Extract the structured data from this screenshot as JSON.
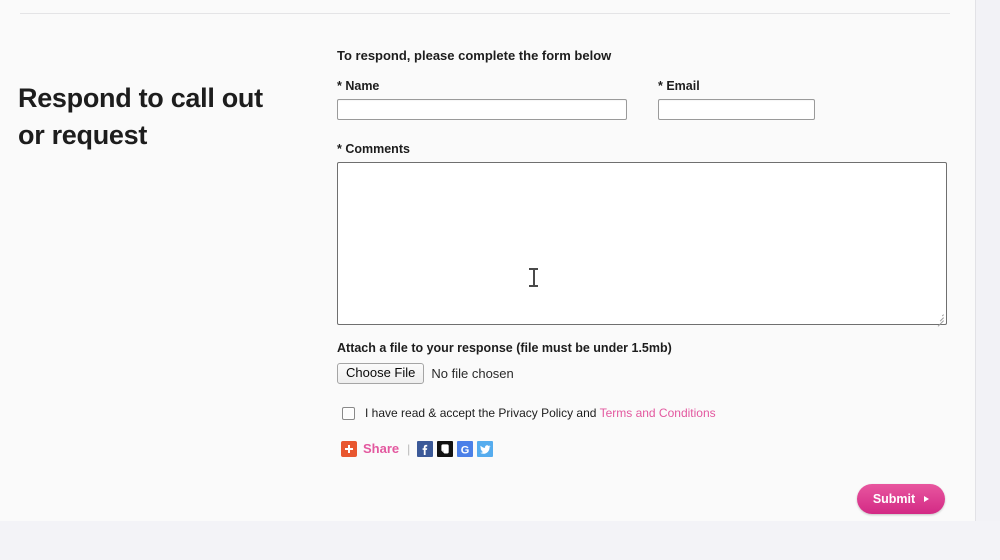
{
  "page": {
    "title_line1": "Respond to call out",
    "title_line2": "or request"
  },
  "form": {
    "intro": "To respond, please complete the form below",
    "name_label": "* Name",
    "name_value": "",
    "name_placeholder": "",
    "email_label": "* Email",
    "email_value": "",
    "email_placeholder": "",
    "comments_label": "* Comments",
    "comments_value": "",
    "comments_placeholder": "",
    "attach_label": "Attach a file to your response (file must be under 1.5mb)",
    "choose_file_label": "Choose File",
    "no_file_text": "No file chosen",
    "consent_text": "I have read & accept the Privacy Policy and ",
    "terms_link": "Terms and Conditions",
    "submit_label": "Submit"
  },
  "share": {
    "plus_icon": "addthis-plus-icon",
    "label": "Share",
    "separator": "|",
    "buttons": [
      {
        "name": "facebook-share-icon",
        "label": "Facebook",
        "color": "#3b5998"
      },
      {
        "name": "evernote-share-icon",
        "label": "Evernote",
        "color": "#111111"
      },
      {
        "name": "google-share-icon",
        "label": "Google",
        "color": "#4285f4"
      },
      {
        "name": "twitter-share-icon",
        "label": "Twitter",
        "color": "#55acee"
      }
    ]
  },
  "colors": {
    "accent_pink": "#e3589f",
    "submit_pink": "#d32a85",
    "addthis_orange": "#e8562f",
    "page_background": "#fafafa",
    "outer_background": "#f2f2f6"
  }
}
